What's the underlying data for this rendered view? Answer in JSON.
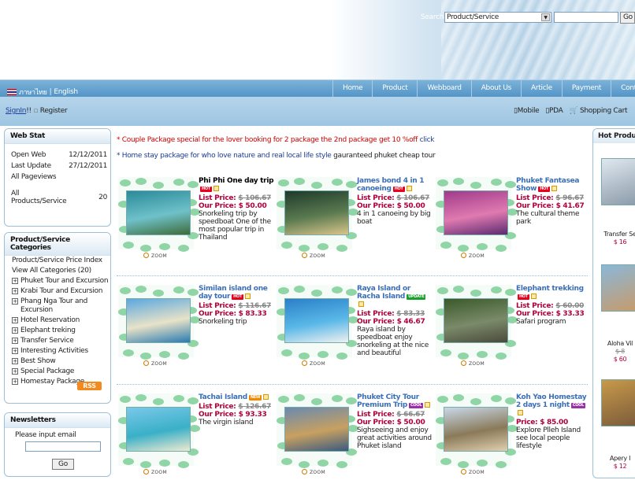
{
  "header": {
    "search_label": "Search",
    "search_select": "Product/Service",
    "search_go": "Go"
  },
  "nav": {
    "lang_thai": "ภาษาไทย",
    "lang_sep": "|",
    "lang_english": "English",
    "items": [
      "Home",
      "Product",
      "Webboard",
      "About Us",
      "Article",
      "Payment",
      "Contact Us"
    ]
  },
  "subbar": {
    "signin": "SignIn",
    "signin_suffix": "!!",
    "register": "Register",
    "mobile": "Mobile",
    "pda": "PDA",
    "cart": "Shopping Cart"
  },
  "webstat": {
    "title": "Web Stat",
    "rows": [
      {
        "label": "Open Web",
        "value": "12/12/2011"
      },
      {
        "label": "Last Update",
        "value": "27/12/2011"
      },
      {
        "label": "All Pageviews",
        "value": ""
      },
      {
        "label": "All Products/Service",
        "value": "20"
      }
    ]
  },
  "categories": {
    "title": "Product/Service Categories",
    "price_index": "Product/Service Price Index",
    "view_all": "View All Categories (20)",
    "items": [
      "Phuket Tour and Excursion",
      "Krabi Tour and Excursion",
      "Phang Nga Tour and Excursion",
      "Hotel Reservation",
      "Elephant treking",
      "Transfer Service",
      "Interesting Activities",
      "Best Show",
      "Special Package",
      "Homestay Package"
    ],
    "rss": "RSS"
  },
  "newsletter": {
    "title": "Newsletters",
    "label": "Please input email",
    "go": "Go"
  },
  "promos": {
    "line1": "* Couple Package special for the lover booking for 2 package the 2nd package get 10 %off",
    "line1_link": "click",
    "line2": "* Home stay package for who love nature and real local life style",
    "line2_tail": "gauranteed phuket cheap tour"
  },
  "labels": {
    "list_price": "List Price:",
    "our_price": "Our Price:",
    "price": "Price:",
    "zoom": "ZOOM"
  },
  "products": [
    {
      "title": "Phi Phi One day trip",
      "badge": "HOT",
      "list": "$ 106.67",
      "our": "$ 50.00",
      "desc": "Snorkeling trip by speedboat One of the most popular trip in Thailand",
      "colors": [
        "#2a8a9a",
        "#6fc1c9",
        "#3d6b3a"
      ]
    },
    {
      "title": "James bond 4 in 1 canoeing",
      "badge": "HOT",
      "list": "$ 106.67",
      "our": "$ 50.00",
      "desc": "4 in 1 canoeing by big boat",
      "colors": [
        "#1e3a2a",
        "#5a7a50",
        "#d9c58a"
      ]
    },
    {
      "title": "Phuket Fantasea Show",
      "badge": "HOT",
      "list": "$ 96.67",
      "our": "$ 41.67",
      "desc": "The cultural theme park",
      "colors": [
        "#a03a8a",
        "#e07ab0",
        "#5a2a70"
      ]
    },
    {
      "title": "Similan island one day tour",
      "badge": "HOT",
      "list": "$ 116.67",
      "our": "$ 83.33",
      "desc": "Snorkeling trip",
      "colors": [
        "#5aa8e0",
        "#e8e2c8",
        "#2a7ab0"
      ]
    },
    {
      "title": "Raya Island or Racha Island",
      "badge": "UPDATE",
      "list": "$ 83.33",
      "our": "$ 46.67",
      "desc": "Raya island by speedboat enjoy snorkeling at the nice and beautiful",
      "colors": [
        "#2a80c8",
        "#5ab8e8",
        "#f0f0f0"
      ]
    },
    {
      "title": "Elephant trekking",
      "badge": "HOT",
      "list": "$ 60.00",
      "our": "$ 33.33",
      "desc": "Safari program",
      "colors": [
        "#3a5a2a",
        "#7a8a6a",
        "#4a4a3a"
      ]
    },
    {
      "title": "Tachai Island",
      "badge": "NEW",
      "list": "$ 126.67",
      "our": "$ 93.33",
      "desc": "The virgin island",
      "colors": [
        "#7ac8e8",
        "#3ab0c8",
        "#f0ead0"
      ]
    },
    {
      "title": "Phuket City Tour Premium Trip",
      "badge": "COOL",
      "list": "$ 66.67",
      "our": "$ 50.00",
      "desc": "Sighseeing and enjoy great activities around Phuket island",
      "colors": [
        "#6a8ab0",
        "#c8a060",
        "#3a5a80"
      ]
    },
    {
      "title": "Koh Yao Homestay 2 days 1 night",
      "badge": "COOL",
      "price": "$ 85.00",
      "desc": "Explore Plleh Island see local people lifestyle",
      "colors": [
        "#c8d8e8",
        "#8a7a5a",
        "#e0d0b0"
      ]
    }
  ],
  "hot": {
    "title": "Hot Products",
    "items": [
      {
        "name": "Transfer Se",
        "value": "$ 16",
        "colors": [
          "#dfe8f0",
          "#8a9aa8"
        ]
      },
      {
        "name": "Aloha Vil",
        "value": "$ 60",
        "prev": "$ 8",
        "colors": [
          "#8ab8d8",
          "#c89a6a"
        ]
      },
      {
        "name": "Apery I",
        "value": "$ 12",
        "colors": [
          "#c89a4a",
          "#7a5a3a"
        ]
      }
    ]
  }
}
